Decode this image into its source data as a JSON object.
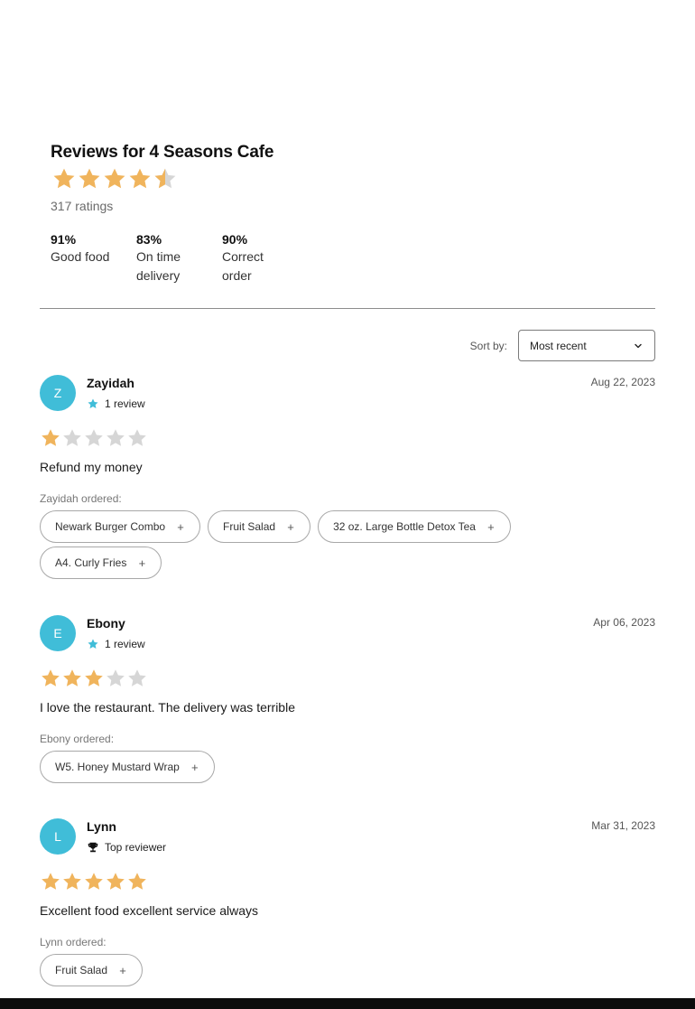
{
  "summary": {
    "title": "Reviews for 4 Seasons Cafe",
    "rating_value": 4.5,
    "rating_max": 5,
    "ratings_count": "317 ratings",
    "stats": [
      {
        "pct": "91%",
        "label": "Good food"
      },
      {
        "pct": "83%",
        "label": "On time delivery"
      },
      {
        "pct": "90%",
        "label": "Correct order"
      }
    ]
  },
  "sort": {
    "label": "Sort by:",
    "selected": "Most recent"
  },
  "reviews": [
    {
      "initial": "Z",
      "name": "Zayidah",
      "badge_icon": "star-icon",
      "badge": "1 review",
      "date": "Aug 22, 2023",
      "rating": 1,
      "text": "Refund my money",
      "ordered_label": "Zayidah ordered:",
      "items": [
        "Newark Burger Combo",
        "Fruit Salad",
        "32 oz. Large Bottle Detox Tea",
        "A4. Curly Fries"
      ]
    },
    {
      "initial": "E",
      "name": "Ebony",
      "badge_icon": "star-icon",
      "badge": "1 review",
      "date": "Apr 06, 2023",
      "rating": 3,
      "text": "I love the restaurant. The delivery was terrible",
      "ordered_label": "Ebony ordered:",
      "items": [
        "W5. Honey Mustard Wrap"
      ]
    },
    {
      "initial": "L",
      "name": "Lynn",
      "badge_icon": "trophy-icon",
      "badge": "Top reviewer",
      "date": "Mar 31, 2023",
      "rating": 5,
      "text": "Excellent food excellent service always",
      "ordered_label": "Lynn ordered:",
      "items": [
        "Fruit Salad"
      ]
    }
  ],
  "colors": {
    "star_filled": "#f0b45c",
    "star_empty": "#d6d6d6",
    "avatar": "#40bdd8",
    "badge_star": "#40bdd8"
  }
}
